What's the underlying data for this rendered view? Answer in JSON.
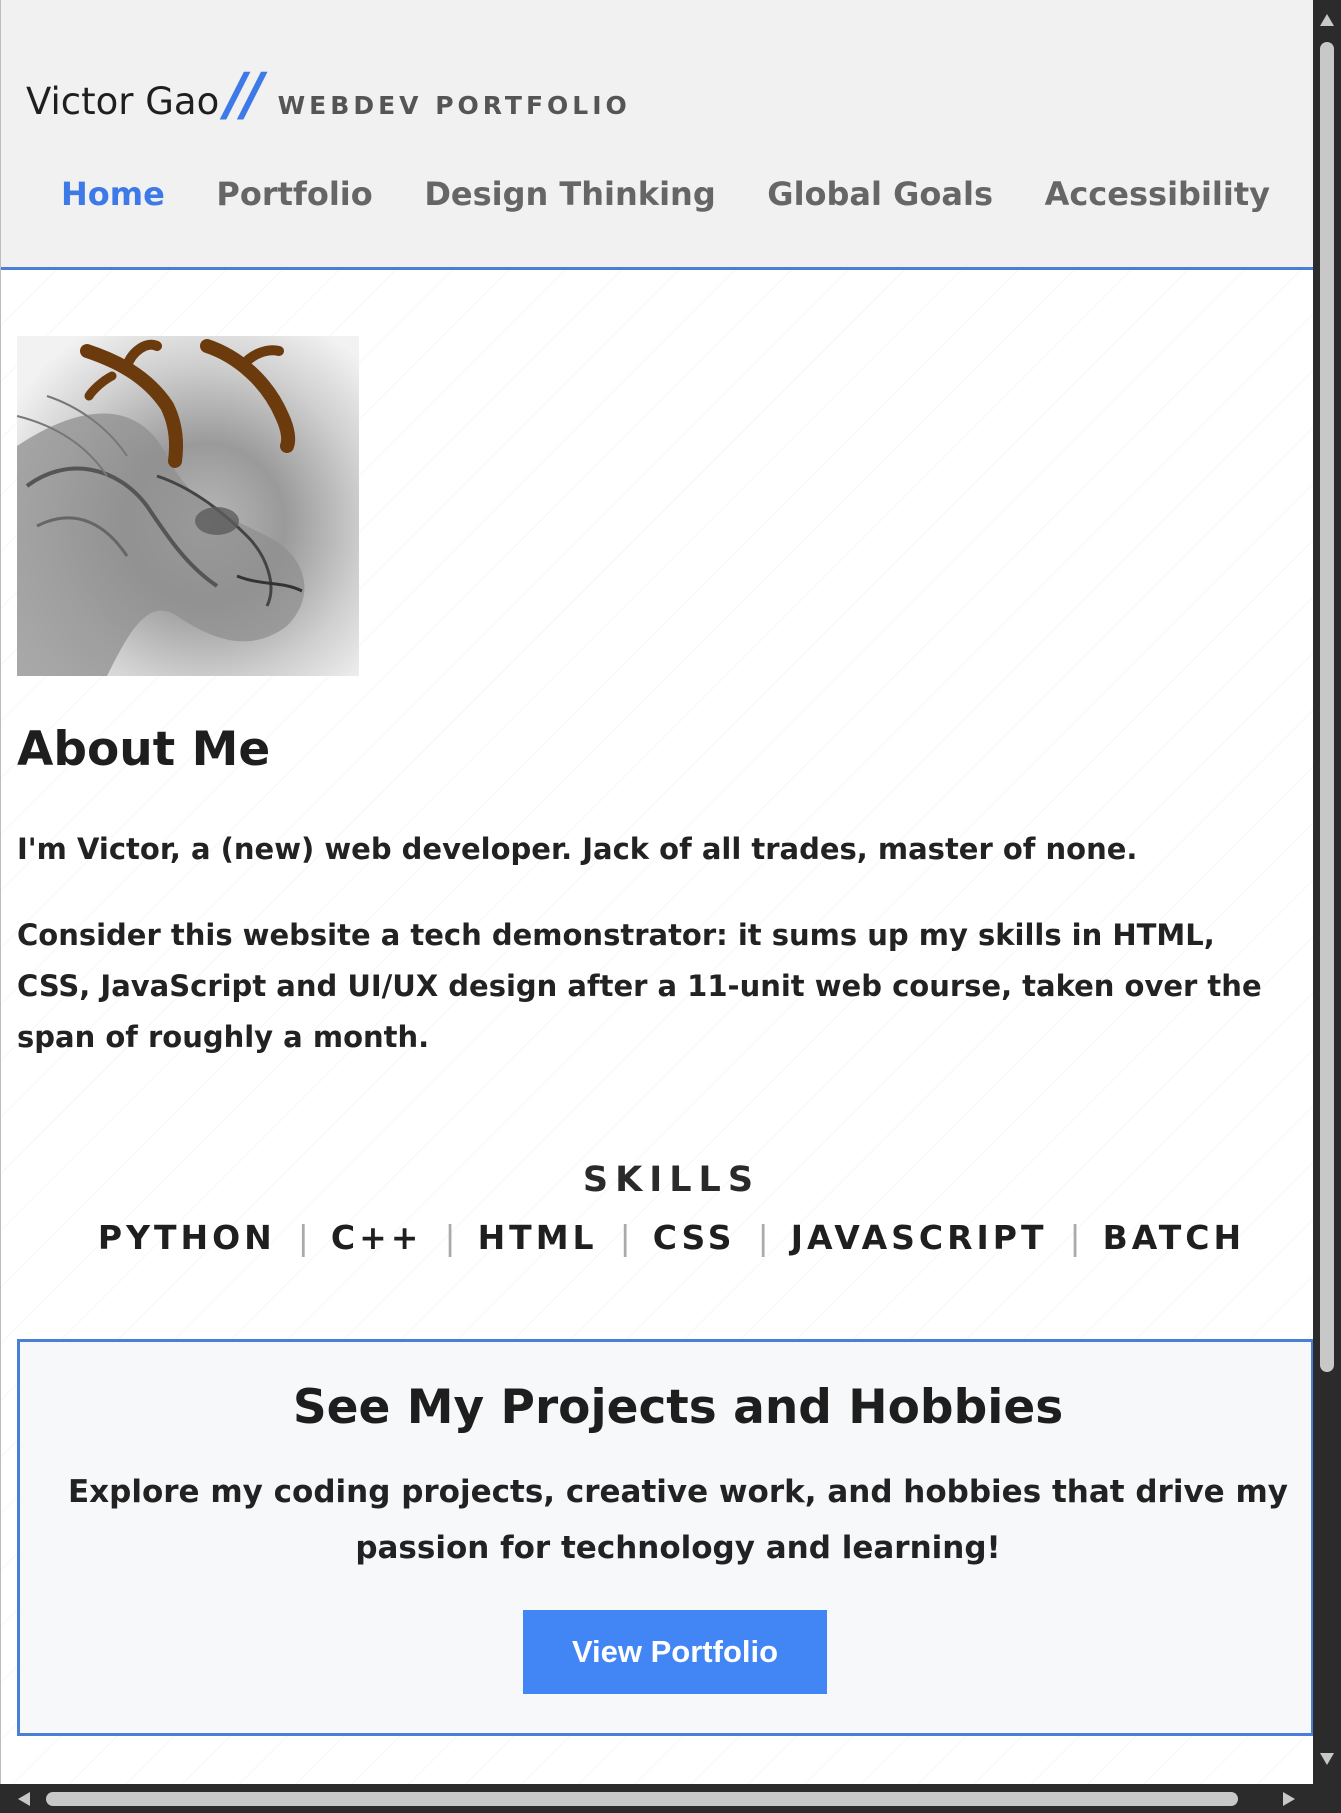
{
  "header": {
    "brand_name": "Victor Gao",
    "brand_slashes": "//",
    "brand_subtitle": "WEBDEV PORTFOLIO"
  },
  "nav": {
    "items": [
      {
        "label": "Home",
        "active": true
      },
      {
        "label": "Portfolio",
        "active": false
      },
      {
        "label": "Design Thinking",
        "active": false
      },
      {
        "label": "Global Goals",
        "active": false
      },
      {
        "label": "Accessibility",
        "active": false
      }
    ]
  },
  "about": {
    "title": "About Me",
    "paragraph1": "I'm Victor, a (new) web developer. Jack of all trades, master of none.",
    "paragraph2": "Consider this website a tech demonstrator: it sums up my skills in HTML, CSS, JavaScript and UI/UX design after a 11-unit web course, taken over the span of roughly a month."
  },
  "skills": {
    "title": "SKILLS",
    "items": [
      "PYTHON",
      "C++",
      "HTML",
      "CSS",
      "JAVASCRIPT",
      "BATCH"
    ],
    "separator": "|"
  },
  "cta": {
    "title": "See My Projects and Hobbies",
    "text": "Explore my coding projects, creative work, and hobbies that drive my passion for technology and learning!",
    "button_label": "View Portfolio"
  },
  "colors": {
    "accent": "#3d7ae8",
    "button": "#4285f4",
    "header_bg": "#f1f1f1",
    "border": "#4a7fd8"
  },
  "icons": {
    "avatar": "dragon-illustration"
  }
}
